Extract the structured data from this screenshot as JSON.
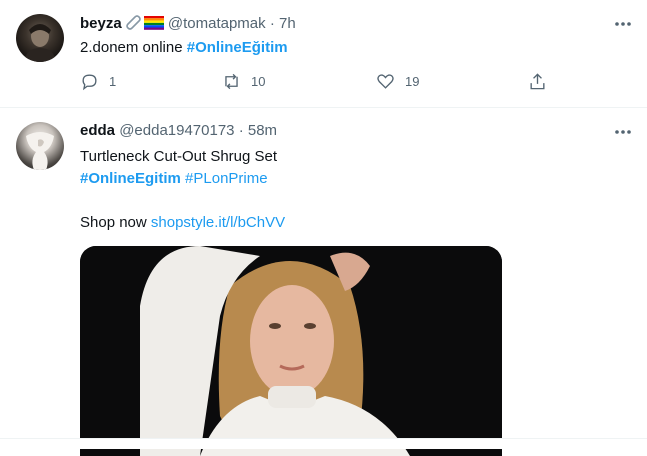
{
  "tweets": [
    {
      "name": "beyza",
      "handle": "@tomatapmak",
      "time": "· 7h",
      "text": "2.donem online",
      "hashtag": "#OnlineEğitim",
      "replies": "1",
      "retweets": "10",
      "likes": "19"
    },
    {
      "name": "edda",
      "handle": "@edda19470173",
      "time": "· 58m",
      "line1": "Turtleneck Cut-Out Shrug Set",
      "hashtag1": "#OnlineEgitim",
      "hashtag2": "#PLonPrime",
      "shop_label": "Shop now",
      "shop_link": "shopstyle.it/l/bChVV"
    }
  ],
  "colors": {
    "accent": "#1d9bf0",
    "secondary_text": "#536471"
  },
  "icons": [
    "paperclip-icon",
    "rainbow-flag-icon",
    "more-icon",
    "reply-icon",
    "retweet-icon",
    "like-icon",
    "share-icon"
  ]
}
